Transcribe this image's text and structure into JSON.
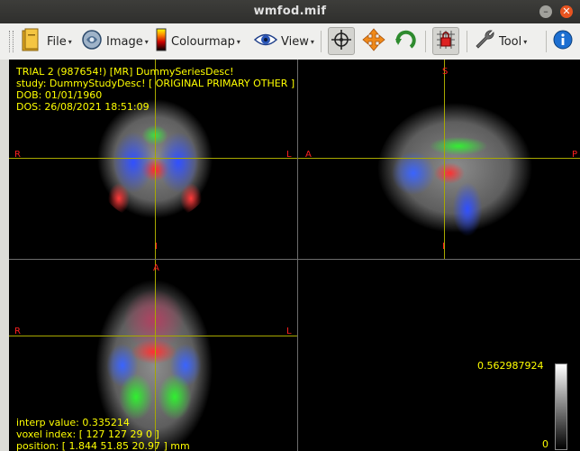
{
  "window": {
    "title": "wmfod.mif",
    "minimize_glyph": "–",
    "close_glyph": "✕"
  },
  "toolbar": {
    "file_label": "File",
    "image_label": "Image",
    "colourmap_label": "Colourmap",
    "view_label": "View",
    "tool_label": "Tool",
    "dropdown_glyph": "▾",
    "icons": [
      "file-icon",
      "image-icon",
      "colourmap-icon",
      "view-eye-icon",
      "focus-crosshair-icon",
      "move-icon",
      "rotate-icon",
      "lock-grid-icon",
      "tool-wrench-icon",
      "info-icon"
    ]
  },
  "patient_info": {
    "line1": "TRIAL 2 (987654!) [MR] DummySeriesDesc!",
    "line2": "study: DummyStudyDesc! [ ORIGINAL PRIMARY OTHER ]",
    "line3": "DOB: 01/01/1960",
    "line4": "DOS: 26/08/2021 18:51:09"
  },
  "orientation": {
    "coronal": {
      "left": "R",
      "right": "L",
      "bottom": "I"
    },
    "sagittal": {
      "top": "S",
      "left": "A",
      "right": "P",
      "bottom": "I"
    },
    "axial": {
      "top": "A",
      "left": "R",
      "right": "L"
    }
  },
  "status": {
    "interp": "interp value: 0.335214",
    "voxel": "voxel index: [ 127 127 29 0 ]",
    "position": "position: [ 1.844 51.85 20.97 ] mm"
  },
  "colorbar": {
    "max": "0.562987924",
    "min": "0"
  },
  "colors": {
    "overlay_text": "#ffff00",
    "orientation_labels": "#ff2020",
    "crosshair": "#a8a800",
    "close_button": "#e95420"
  }
}
